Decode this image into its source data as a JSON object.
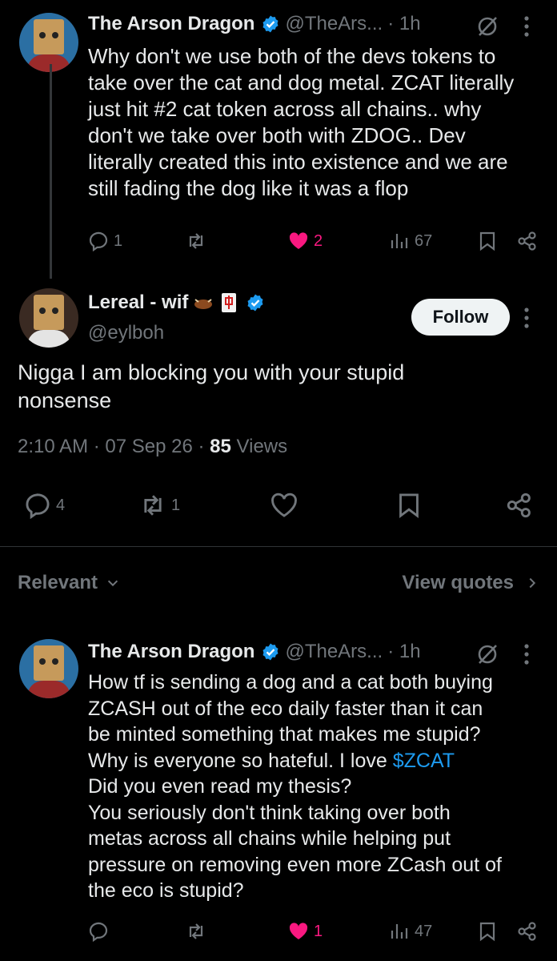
{
  "parent_tweet": {
    "author_name": "The Arson Dragon",
    "handle": "@TheArs...",
    "time": "· 1h",
    "text": "Why don't we use both of the devs tokens to\ntake over the cat and dog metal. ZCAT literally\njust hit #2 cat token across all chains.. why\ndon't we take over both with ZDOG.. Dev\nliterally created this into existence and we are\nstill fading the dog like it was a flop",
    "replies": "1",
    "retweets": "",
    "likes": "2",
    "views": "67"
  },
  "focused_tweet": {
    "author_name": "Lereal - wif",
    "handle": "@eylboh",
    "follow_label": "Follow",
    "text": "Nigga I am blocking you with your stupid\nnonsense",
    "timestamp": "2:10 AM · 07 Sep 26 ·",
    "views_count": "85",
    "views_label": "Views",
    "replies": "4",
    "retweets": "1"
  },
  "sort_bar": {
    "relevant_label": "Relevant",
    "view_quotes_label": "View quotes"
  },
  "reply_tweet": {
    "author_name": "The Arson Dragon",
    "handle": "@TheArs...",
    "time": "· 1h",
    "text_before_cashtag": "How tf is sending a dog and a cat both buying\nZCASH out of the eco daily faster than it can\nbe minted something that makes me stupid?\nWhy is everyone so hateful. I love ",
    "cashtag": "$ZCAT",
    "text_after_cashtag": "\nDid you even read my thesis?\nYou seriously don't think taking over both\nmetas across all chains while helping put\npressure on removing even more ZCash out of\nthe eco is stupid?",
    "replies": "",
    "likes": "1",
    "views": "47"
  },
  "colors": {
    "background": "#000000",
    "text": "#e7e9ea",
    "secondary": "#71767b",
    "like": "#f91880",
    "link": "#1d9bf0",
    "verified": "#1d9bf0"
  }
}
